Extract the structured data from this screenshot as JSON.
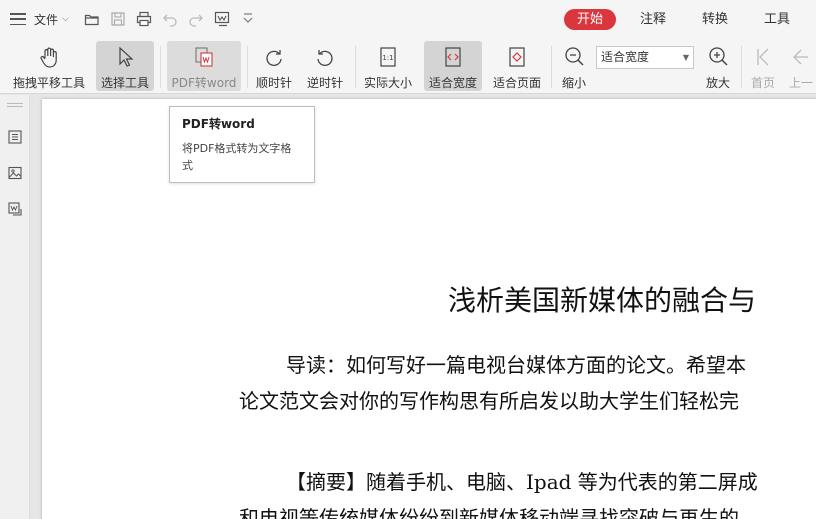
{
  "topbar": {
    "file_label": "文件",
    "quick_access_icons": [
      "open-folder-icon",
      "save-icon",
      "print-icon",
      "undo-icon",
      "redo-icon",
      "convert-icon",
      "customize-icon"
    ],
    "tabs": [
      {
        "label": "开始",
        "active": true
      },
      {
        "label": "注释",
        "active": false
      },
      {
        "label": "转换",
        "active": false
      },
      {
        "label": "工具",
        "active": false
      }
    ],
    "accent_color": "#d9363e"
  },
  "ribbon": {
    "hand_tool": "拖拽平移工具",
    "select_tool": "选择工具",
    "pdf_to_word": "PDF转word",
    "rotate_cw": "顺时针",
    "rotate_ccw": "逆时针",
    "actual_size": "实际大小",
    "fit_width": "适合宽度",
    "fit_page": "适合页面",
    "zoom_out": "缩小",
    "zoom_value": "适合宽度",
    "zoom_in": "放大",
    "first_page": "首页",
    "prev_page": "上一"
  },
  "tooltip": {
    "title": "PDF转word",
    "description": "将PDF格式转为文字格式"
  },
  "document": {
    "title": "浅析美国新媒体的融合与",
    "lines": [
      "导读：如何写好一篇电视台媒体方面的论文。希望本",
      "论文范文会对你的写作构思有所启发以助大学生们轻松完",
      "【摘要】随着手机、电脑、Ipad 等为代表的第二屏成",
      "和电视等传统媒体纷纷到新媒体移动端寻找突破与再生的"
    ]
  }
}
